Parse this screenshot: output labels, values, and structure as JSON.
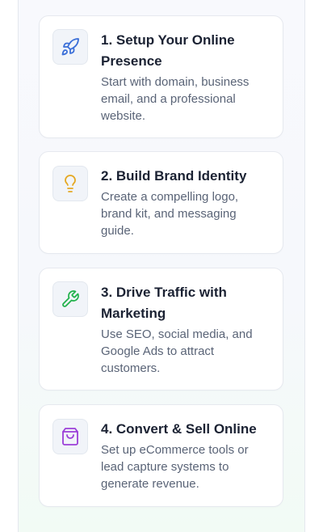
{
  "steps": [
    {
      "title": "1. Setup Your Online Presence",
      "description": "Start with domain, business email, and a professional website.",
      "icon": "rocket-icon",
      "icon_color": "#3b6fd8"
    },
    {
      "title": "2. Build Brand Identity",
      "description": "Create a compelling logo, brand kit, and messaging guide.",
      "icon": "lightbulb-icon",
      "icon_color": "#e5a823"
    },
    {
      "title": "3. Drive Traffic with Marketing",
      "description": "Use SEO, social media, and Google Ads to attract customers.",
      "icon": "wrench-icon",
      "icon_color": "#22b24c"
    },
    {
      "title": "4. Convert & Sell Online",
      "description": "Set up eCommerce tools or lead capture systems to generate revenue.",
      "icon": "shopping-bag-icon",
      "icon_color": "#9b3fd8"
    }
  ]
}
